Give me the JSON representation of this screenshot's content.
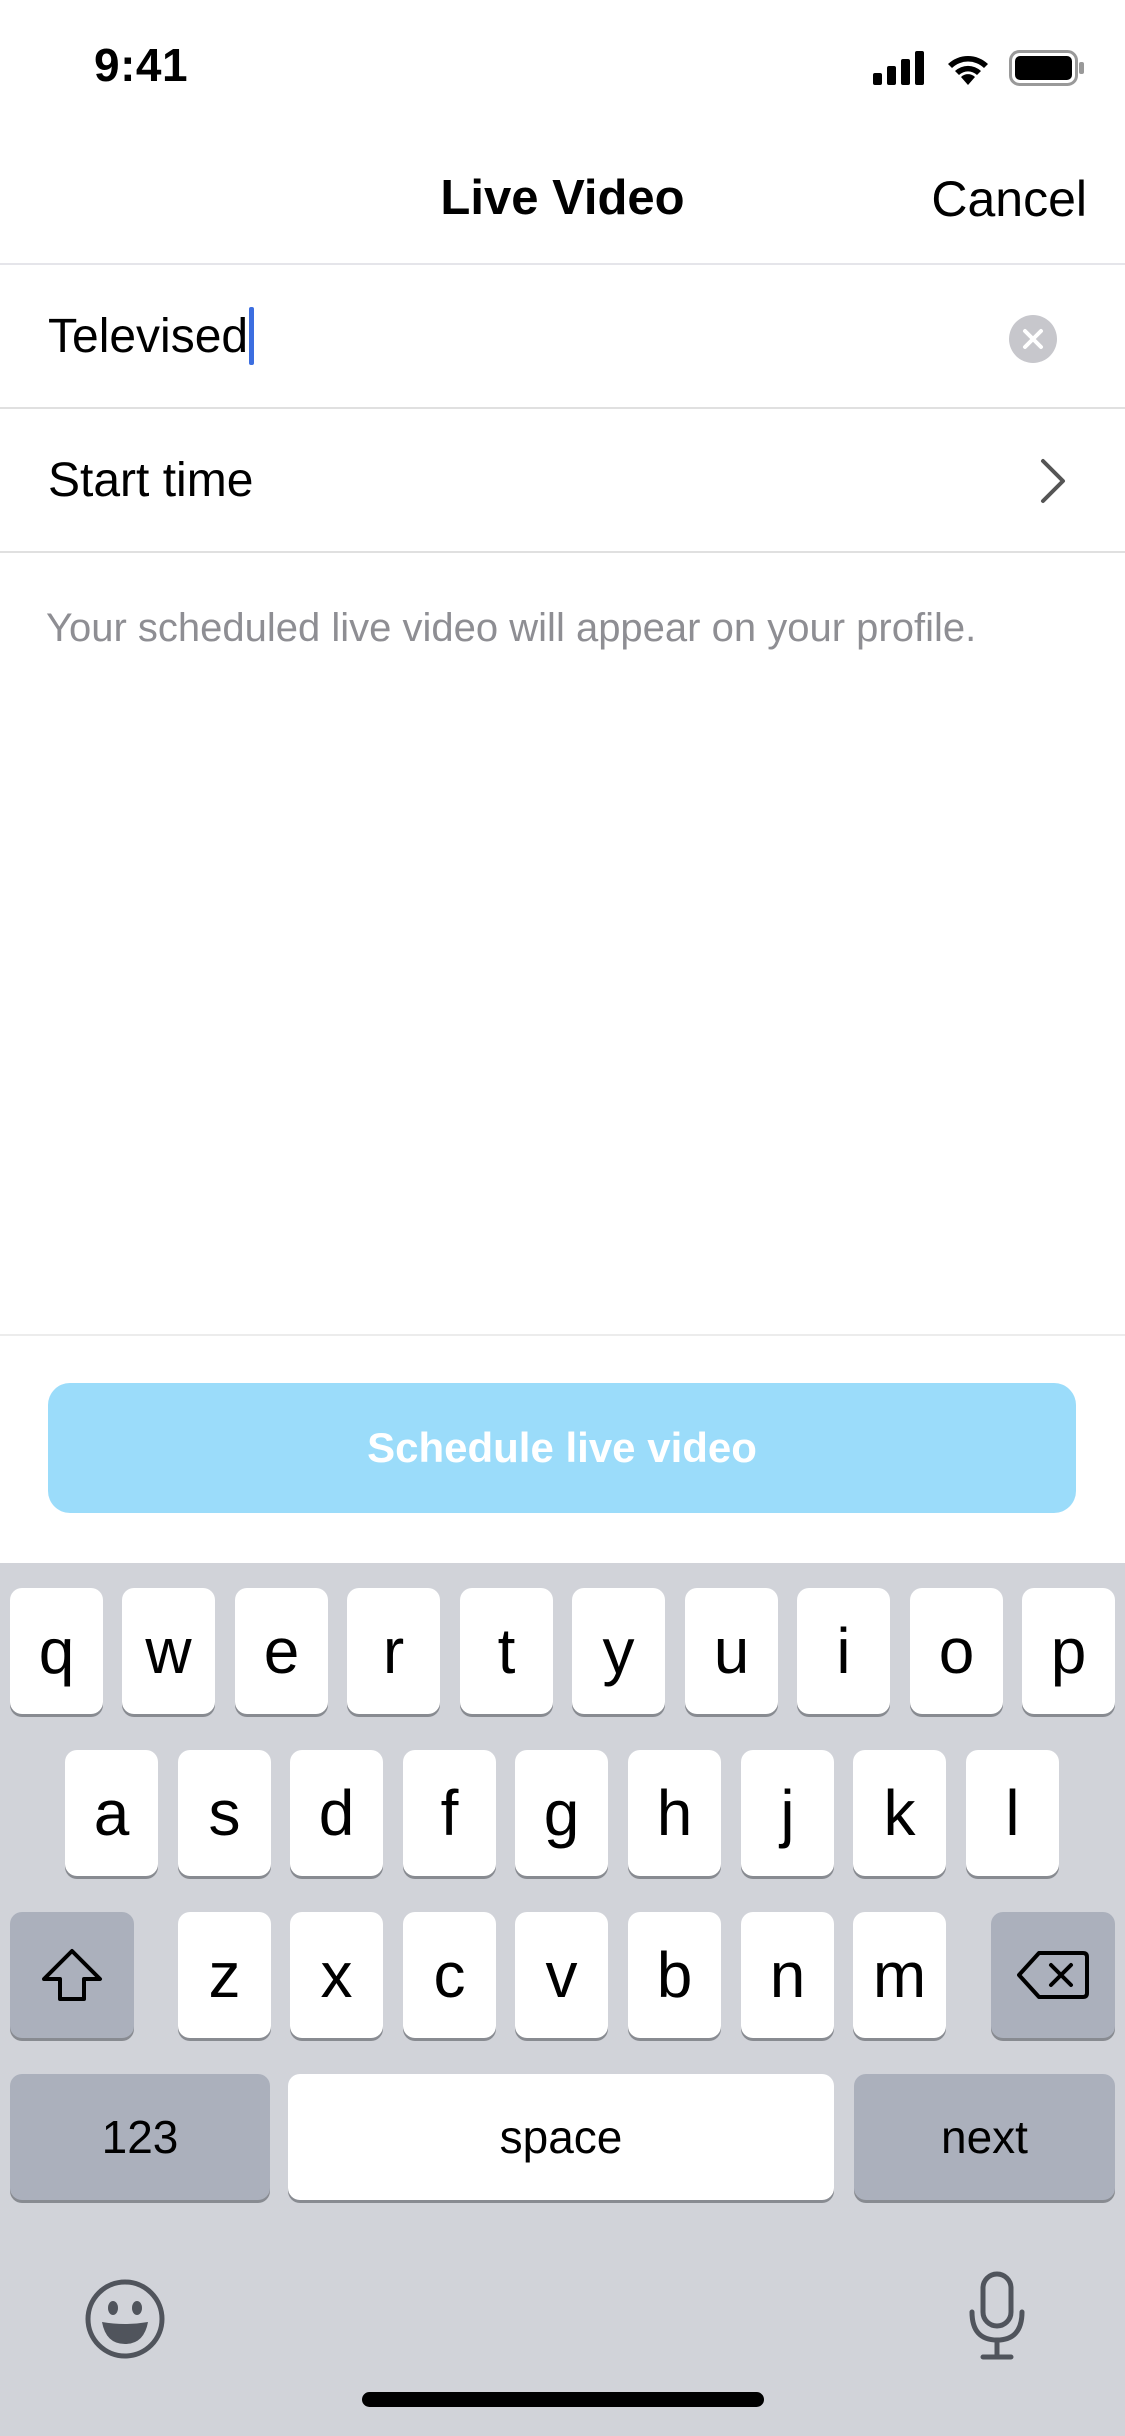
{
  "status_bar": {
    "time": "9:41"
  },
  "nav": {
    "title": "Live Video",
    "cancel_label": "Cancel"
  },
  "form": {
    "title_value": "Televised",
    "start_time_label": "Start time",
    "helper_text": "Your scheduled live video will appear on your profile."
  },
  "schedule_button": {
    "label": "Schedule live video",
    "color": "#9bdcfa"
  },
  "keyboard": {
    "row1": [
      "q",
      "w",
      "e",
      "r",
      "t",
      "y",
      "u",
      "i",
      "o",
      "p"
    ],
    "row2": [
      "a",
      "s",
      "d",
      "f",
      "g",
      "h",
      "j",
      "k",
      "l"
    ],
    "row3": [
      "z",
      "x",
      "c",
      "v",
      "b",
      "n",
      "m"
    ],
    "numbers_label": "123",
    "space_label": "space",
    "return_label": "next",
    "shift_icon": "shift-icon",
    "delete_icon": "backspace-icon",
    "emoji_icon": "emoji-icon",
    "mic_icon": "microphone-icon"
  },
  "colors": {
    "cursor": "#3c6ee0",
    "keyboard_bg": "#d1d3d9"
  }
}
